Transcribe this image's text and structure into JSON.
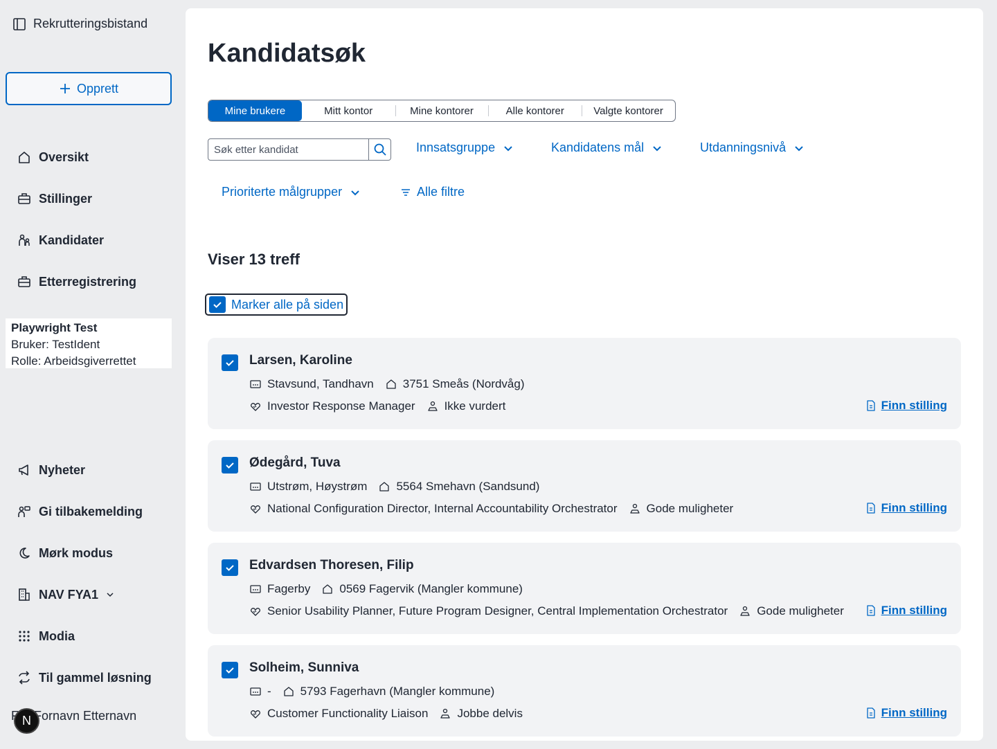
{
  "sidebar": {
    "app_title": "Rekrutteringsbistand",
    "create_label": "Opprett",
    "nav_top": [
      {
        "label": "Oversikt",
        "icon": "home-icon"
      },
      {
        "label": "Stillinger",
        "icon": "briefcase-icon"
      },
      {
        "label": "Kandidater",
        "icon": "people-icon"
      },
      {
        "label": "Etterregistrering",
        "icon": "briefcase-icon"
      }
    ],
    "user": {
      "name": "Playwright Test",
      "ident": "Bruker: TestIdent",
      "role": "Rolle: Arbeidsgiverrettet"
    },
    "nav_bottom": [
      {
        "label": "Nyheter",
        "icon": "megaphone-icon"
      },
      {
        "label": "Gi tilbakemelding",
        "icon": "feedback-icon"
      },
      {
        "label": "Mørk modus",
        "icon": "moon-icon"
      },
      {
        "label": "NAV FYA1",
        "icon": "building-icon"
      },
      {
        "label": "Modia",
        "icon": "grid-icon"
      },
      {
        "label": "Til gammel løsning",
        "icon": "swap-icon"
      }
    ],
    "profile_name": "Fornavn Etternavn",
    "profile_initials": "FE",
    "dev_badge": "N"
  },
  "main": {
    "title": "Kandidatsøk",
    "tabs": [
      "Mine brukere",
      "Mitt kontor",
      "Mine kontorer",
      "Alle kontorer",
      "Valgte kontorer"
    ],
    "active_tab": "Mine brukere",
    "search_placeholder": "Søk etter kandidat",
    "filters": {
      "innsatsgruppe": "Innsatsgruppe",
      "maal": "Kandidatens mål",
      "utdanning": "Utdanningsnivå",
      "prioriterte": "Prioriterte målgrupper",
      "alle": "Alle filtre"
    },
    "hits": "Viser 13 treff",
    "select_all": "Marker alle på siden",
    "candidates": [
      {
        "name": "Larsen, Karoline",
        "location": "Stavsund, Tandhavn",
        "address": "3751 Smeås (Nordvåg)",
        "jobs": "Investor Response Manager",
        "status": "Ikke vurdert",
        "action": "Finn stilling",
        "checked": true
      },
      {
        "name": "Ødegård, Tuva",
        "location": "Utstrøm, Høystrøm",
        "address": "5564 Smehavn (Sandsund)",
        "jobs": "National Configuration Director, Internal Accountability Orchestrator",
        "status": "Gode muligheter",
        "action": "Finn stilling",
        "checked": true
      },
      {
        "name": "Edvardsen Thoresen, Filip",
        "location": "Fagerby",
        "address": "0569 Fagervik (Mangler kommune)",
        "jobs": "Senior Usability Planner, Future Program Designer, Central Implementation Orchestrator",
        "status": "Gode muligheter",
        "action": "Finn stilling",
        "checked": true
      },
      {
        "name": "Solheim, Sunniva",
        "location": "-",
        "address": "5793 Fagerhavn (Mangler kommune)",
        "jobs": "Customer Functionality Liaison",
        "status": "Jobbe delvis",
        "action": "Finn stilling",
        "checked": true
      }
    ]
  },
  "colors": {
    "accent": "#0067c5",
    "background": "#ecedef",
    "card": "#f2f3f5",
    "text": "#202733"
  }
}
